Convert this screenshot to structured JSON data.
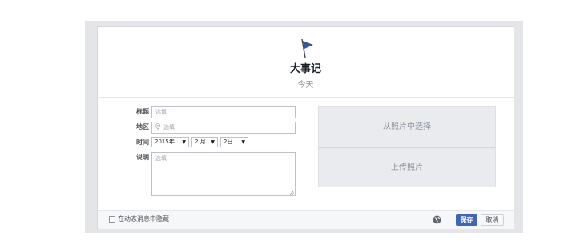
{
  "header": {
    "icon": "flag-icon",
    "title": "大事记",
    "subtitle": "今天"
  },
  "form": {
    "title_label": "标题",
    "title_placeholder": "选填",
    "location_label": "地区",
    "location_icon": "pin-icon",
    "location_placeholder": "选填",
    "time_label": "时间",
    "year_value": "2015年",
    "month_value": "2 月",
    "day_value": "2日",
    "description_label": "说明",
    "description_placeholder": "选填"
  },
  "photos": {
    "choose_label": "从照片中选择",
    "upload_label": "上传照片"
  },
  "footer": {
    "hide_label": "在动态消息中隐藏",
    "privacy_icon": "globe-icon",
    "save_label": "保存",
    "cancel_label": "取消"
  },
  "colors": {
    "primary": "#4267b2",
    "flag": "#365899"
  }
}
